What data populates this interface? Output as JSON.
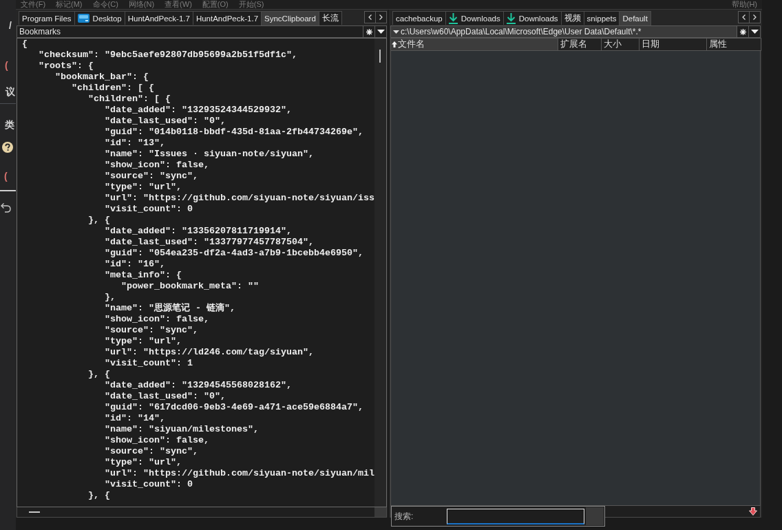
{
  "background_window": {
    "items": [
      {
        "kind": "text",
        "text": "/",
        "color": "#d4d4d4"
      },
      {
        "kind": "text",
        "text": "(",
        "color": "#d9736f"
      },
      {
        "kind": "text",
        "text": "议",
        "color": "#d4d4d4"
      },
      {
        "kind": "text",
        "text": "类",
        "color": "#d4d4d4"
      },
      {
        "kind": "help"
      },
      {
        "kind": "text",
        "text": "(",
        "color": "#d9736f"
      },
      {
        "kind": "undo"
      }
    ]
  },
  "menu_bar": {
    "items": [
      "文件(F)",
      "标记(M)",
      "命令(C)",
      "网络(N)",
      "查看(W)",
      "配置(O)",
      "开始(S)"
    ],
    "help": "帮助(H)"
  },
  "panels": [
    {
      "kind": "lister",
      "active": false,
      "tabs": [
        {
          "label": "Program Files",
          "kind": "plain",
          "selected": false
        },
        {
          "label": "Desktop",
          "kind": "desktop",
          "selected": false
        },
        {
          "label": "HuntAndPeck-1.7",
          "kind": "plain",
          "selected": false
        },
        {
          "label": "HuntAndPeck-1.7",
          "kind": "plain",
          "selected": false
        },
        {
          "label": "SyncClipboard",
          "kind": "plain",
          "selected": true
        },
        {
          "label": "长流",
          "kind": "plain",
          "selected": false
        }
      ],
      "path": "Bookmarks",
      "lines": [
        "{",
        "   \"checksum\": \"9ebc5aefe92807db95699a2b51f5df1c\",",
        "   \"roots\": {",
        "      \"bookmark_bar\": {",
        "         \"children\": [ {",
        "            \"children\": [ {",
        "               \"date_added\": \"13293524344529932\",",
        "               \"date_last_used\": \"0\",",
        "               \"guid\": \"014b0118-bbdf-435d-81aa-2fb44734269e\",",
        "               \"id\": \"13\",",
        "               \"name\": \"Issues · siyuan-note/siyuan\",",
        "               \"show_icon\": false,",
        "               \"source\": \"sync\",",
        "               \"type\": \"url\",",
        "               \"url\": \"https://github.com/siyuan-note/siyuan/iss",
        "               \"visit_count\": 0",
        "            }, {",
        "               \"date_added\": \"13356207811719914\",",
        "               \"date_last_used\": \"13377977457787504\",",
        "               \"guid\": \"054ea235-df2a-4ad3-a7b9-1bcebb4e6950\",",
        "               \"id\": \"16\",",
        "               \"meta_info\": {",
        "                  \"power_bookmark_meta\": \"\"",
        "               },",
        "               \"name\": \"思源笔记 - 链滴\",",
        "               \"show_icon\": false,",
        "               \"source\": \"sync\",",
        "               \"type\": \"url\",",
        "               \"url\": \"https://ld246.com/tag/siyuan\",",
        "               \"visit_count\": 1",
        "            }, {",
        "               \"date_added\": \"13294545568028162\",",
        "               \"date_last_used\": \"0\",",
        "               \"guid\": \"617dcd06-9eb3-4e69-a471-ace59e6884a7\",",
        "               \"id\": \"14\",",
        "               \"name\": \"siyuan/milestones\",",
        "               \"show_icon\": false,",
        "               \"source\": \"sync\",",
        "               \"type\": \"url\",",
        "               \"url\": \"https://github.com/siyuan-note/siyuan/mil",
        "               \"visit_count\": 0",
        "            }, {"
      ]
    },
    {
      "kind": "file_list",
      "active": true,
      "tabs": [
        {
          "label": "cachebackup",
          "kind": "plain",
          "selected": false
        },
        {
          "label": "Downloads",
          "kind": "download",
          "selected": false
        },
        {
          "label": "Downloads",
          "kind": "download",
          "selected": false
        },
        {
          "label": "视频",
          "kind": "plain",
          "selected": false
        },
        {
          "label": "snippets",
          "kind": "plain",
          "selected": false
        },
        {
          "label": "Default",
          "kind": "plain",
          "selected": true
        }
      ],
      "path": "c:\\Users\\w60\\AppData\\Local\\Microsoft\\Edge\\User Data\\Default\\*.*",
      "columns": [
        {
          "label": "文件名",
          "sorted": true
        },
        {
          "label": "扩展名",
          "sorted": false
        },
        {
          "label": "大小",
          "sorted": false
        },
        {
          "label": "日期",
          "sorted": false
        },
        {
          "label": "属性",
          "sorted": false
        }
      ]
    }
  ],
  "quick_search": {
    "label": "搜索:"
  }
}
